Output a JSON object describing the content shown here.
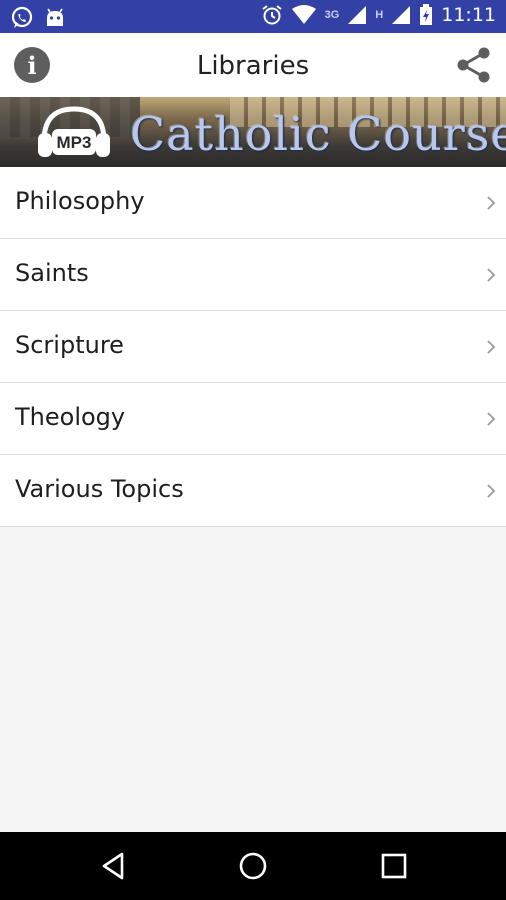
{
  "status_bar": {
    "network_3g": "3G",
    "network_h": "H",
    "time": "11:11",
    "icons": [
      "whatsapp-icon",
      "android-icon",
      "alarm-icon",
      "wifi-icon",
      "signal-icon",
      "signal-icon",
      "battery-icon"
    ]
  },
  "toolbar": {
    "title": "Libraries",
    "info_glyph": "i",
    "share_icon": "share-icon"
  },
  "banner": {
    "badge": "MP3",
    "title": "Catholic Courses"
  },
  "libraries": [
    {
      "label": "Philosophy"
    },
    {
      "label": "Saints"
    },
    {
      "label": "Scripture"
    },
    {
      "label": "Theology"
    },
    {
      "label": "Various Topics"
    }
  ],
  "nav": {
    "icons": [
      "back-icon",
      "home-icon",
      "recents-icon"
    ]
  },
  "colors": {
    "status_bar": "#3340a5",
    "toolbar": "#ffffff",
    "background": "#f5f5f5"
  }
}
